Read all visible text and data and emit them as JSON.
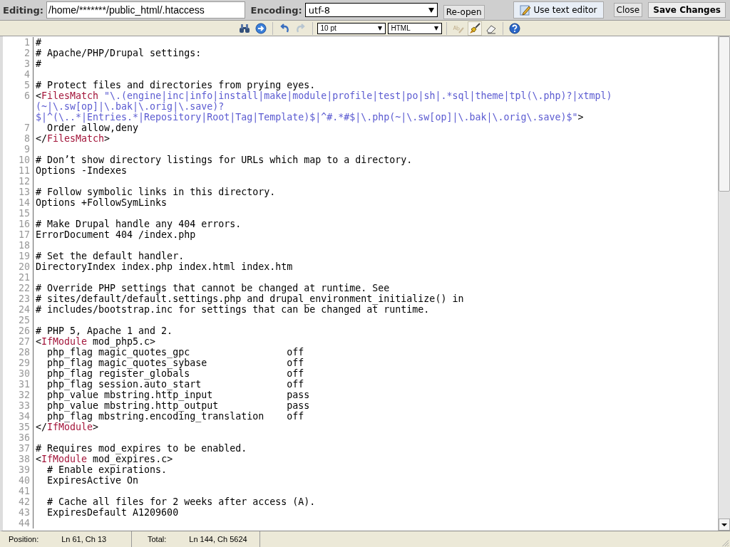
{
  "top_bar": {
    "editing_label": "Editing:",
    "file_path": "/home/*******/public_html/.htaccess",
    "encoding_label": "Encoding:",
    "encoding": "utf-8",
    "buttons": [
      {
        "kind": "reopen",
        "label": "Re-open"
      },
      {
        "kind": "text-editor",
        "label": "Use text editor"
      },
      {
        "kind": "close",
        "label": "Close"
      },
      {
        "kind": "save",
        "label": "Save Changes"
      }
    ]
  },
  "toolbar": [
    {
      "kind": "find",
      "disabled": false,
      "selected": false
    },
    {
      "kind": "goto",
      "disabled": false,
      "selected": false
    },
    {
      "kind": "sep"
    },
    {
      "kind": "undo",
      "disabled": false,
      "selected": false
    },
    {
      "kind": "redo",
      "disabled": true,
      "selected": false
    },
    {
      "kind": "sep"
    },
    {
      "kind": "select",
      "value": "10 pt"
    },
    {
      "kind": "select",
      "value": "HTML"
    },
    {
      "kind": "sep"
    },
    {
      "kind": "spell",
      "disabled": true,
      "selected": false
    },
    {
      "kind": "highlight",
      "disabled": false,
      "selected": true
    },
    {
      "kind": "eraser",
      "disabled": false,
      "selected": false
    },
    {
      "kind": "sep"
    },
    {
      "kind": "help",
      "disabled": false,
      "selected": false
    }
  ],
  "editor": {
    "lines": [
      {
        "number": "1",
        "rows": [
          [
            {
              "kind": "plain",
              "text": "#"
            }
          ]
        ]
      },
      {
        "number": "2",
        "rows": [
          [
            {
              "kind": "plain",
              "text": "# Apache/PHP/Drupal settings:"
            }
          ]
        ]
      },
      {
        "number": "3",
        "rows": [
          [
            {
              "kind": "plain",
              "text": "#"
            }
          ]
        ]
      },
      {
        "number": "4",
        "rows": [
          []
        ]
      },
      {
        "number": "5",
        "rows": [
          [
            {
              "kind": "plain",
              "text": "# Protect files and directories from prying eyes."
            }
          ]
        ]
      },
      {
        "number": "6",
        "rows": [
          [
            {
              "kind": "punct",
              "text": "<"
            },
            {
              "kind": "tag",
              "text": "FilesMatch"
            },
            {
              "kind": "string",
              "text": " \"\\.(engine|inc|info|install|make|module|profile|test|po|sh|.*sql|theme|tpl(\\.php)?|xtmpl)"
            },
            {
              "kind": "break"
            },
            {
              "kind": "string",
              "text": "(~|\\.sw[op]|\\.bak|\\.orig|\\.save)?"
            },
            {
              "kind": "break"
            },
            {
              "kind": "string",
              "text": "$|^(\\..*|Entries.*|Repository|Root|Tag|Template)$|^#.*#$|\\.php(~|\\.sw[op]|\\.bak|\\.orig\\.save)$\""
            },
            {
              "kind": "punct",
              "text": ">"
            }
          ]
        ]
      },
      {
        "number": "7",
        "rows": [
          [
            {
              "kind": "plain",
              "text": "  Order allow,deny"
            }
          ]
        ]
      },
      {
        "number": "8",
        "rows": [
          [
            {
              "kind": "punct",
              "text": "</"
            },
            {
              "kind": "tag",
              "text": "FilesMatch"
            },
            {
              "kind": "punct",
              "text": ">"
            }
          ]
        ]
      },
      {
        "number": "9",
        "rows": [
          []
        ]
      },
      {
        "number": "10",
        "rows": [
          [
            {
              "kind": "plain",
              "text": "# Don’t show directory listings for URLs which map to a directory."
            }
          ]
        ]
      },
      {
        "number": "11",
        "rows": [
          [
            {
              "kind": "plain",
              "text": "Options -Indexes"
            }
          ]
        ]
      },
      {
        "number": "12",
        "rows": [
          []
        ]
      },
      {
        "number": "13",
        "rows": [
          [
            {
              "kind": "plain",
              "text": "# Follow symbolic links in this directory."
            }
          ]
        ]
      },
      {
        "number": "14",
        "rows": [
          [
            {
              "kind": "plain",
              "text": "Options +FollowSymLinks"
            }
          ]
        ]
      },
      {
        "number": "15",
        "rows": [
          []
        ]
      },
      {
        "number": "16",
        "rows": [
          [
            {
              "kind": "plain",
              "text": "# Make Drupal handle any 404 errors."
            }
          ]
        ]
      },
      {
        "number": "17",
        "rows": [
          [
            {
              "kind": "plain",
              "text": "ErrorDocument 404 /index.php"
            }
          ]
        ]
      },
      {
        "number": "18",
        "rows": [
          []
        ]
      },
      {
        "number": "19",
        "rows": [
          [
            {
              "kind": "plain",
              "text": "# Set the default handler."
            }
          ]
        ]
      },
      {
        "number": "20",
        "rows": [
          [
            {
              "kind": "plain",
              "text": "DirectoryIndex index.php index.html index.htm"
            }
          ]
        ]
      },
      {
        "number": "21",
        "rows": [
          []
        ]
      },
      {
        "number": "22",
        "rows": [
          [
            {
              "kind": "plain",
              "text": "# Override PHP settings that cannot be changed at runtime. See"
            }
          ]
        ]
      },
      {
        "number": "23",
        "rows": [
          [
            {
              "kind": "plain",
              "text": "# sites/default/default.settings.php and drupal_environment_initialize() in"
            }
          ]
        ]
      },
      {
        "number": "24",
        "rows": [
          [
            {
              "kind": "plain",
              "text": "# includes/bootstrap.inc for settings that can be changed at runtime."
            }
          ]
        ]
      },
      {
        "number": "25",
        "rows": [
          []
        ]
      },
      {
        "number": "26",
        "rows": [
          [
            {
              "kind": "plain",
              "text": "# PHP 5, Apache 1 and 2."
            }
          ]
        ]
      },
      {
        "number": "27",
        "rows": [
          [
            {
              "kind": "punct",
              "text": "<"
            },
            {
              "kind": "tag",
              "text": "IfModule"
            },
            {
              "kind": "plain",
              "text": " mod_php5.c>"
            }
          ]
        ]
      },
      {
        "number": "28",
        "rows": [
          [
            {
              "kind": "plain",
              "text": "  php_flag magic_quotes_gpc                 off"
            }
          ]
        ]
      },
      {
        "number": "29",
        "rows": [
          [
            {
              "kind": "plain",
              "text": "  php_flag magic_quotes_sybase              off"
            }
          ]
        ]
      },
      {
        "number": "30",
        "rows": [
          [
            {
              "kind": "plain",
              "text": "  php_flag register_globals                 off"
            }
          ]
        ]
      },
      {
        "number": "31",
        "rows": [
          [
            {
              "kind": "plain",
              "text": "  php_flag session.auto_start               off"
            }
          ]
        ]
      },
      {
        "number": "32",
        "rows": [
          [
            {
              "kind": "plain",
              "text": "  php_value mbstring.http_input             pass"
            }
          ]
        ]
      },
      {
        "number": "33",
        "rows": [
          [
            {
              "kind": "plain",
              "text": "  php_value mbstring.http_output            pass"
            }
          ]
        ]
      },
      {
        "number": "34",
        "rows": [
          [
            {
              "kind": "plain",
              "text": "  php_flag mbstring.encoding_translation    off"
            }
          ]
        ]
      },
      {
        "number": "35",
        "rows": [
          [
            {
              "kind": "punct",
              "text": "</"
            },
            {
              "kind": "tag",
              "text": "IfModule"
            },
            {
              "kind": "punct",
              "text": ">"
            }
          ]
        ]
      },
      {
        "number": "36",
        "rows": [
          []
        ]
      },
      {
        "number": "37",
        "rows": [
          [
            {
              "kind": "plain",
              "text": "# Requires mod_expires to be enabled."
            }
          ]
        ]
      },
      {
        "number": "38",
        "rows": [
          [
            {
              "kind": "punct",
              "text": "<"
            },
            {
              "kind": "tag",
              "text": "IfModule"
            },
            {
              "kind": "plain",
              "text": " mod_expires.c>"
            }
          ]
        ]
      },
      {
        "number": "39",
        "rows": [
          [
            {
              "kind": "plain",
              "text": "  # Enable expirations."
            }
          ]
        ]
      },
      {
        "number": "40",
        "rows": [
          [
            {
              "kind": "plain",
              "text": "  ExpiresActive On"
            }
          ]
        ]
      },
      {
        "number": "41",
        "rows": [
          []
        ]
      },
      {
        "number": "42",
        "rows": [
          [
            {
              "kind": "plain",
              "text": "  # Cache all files for 2 weeks after access (A)."
            }
          ]
        ]
      },
      {
        "number": "43",
        "rows": [
          [
            {
              "kind": "plain",
              "text": "  ExpiresDefault A1209600"
            }
          ]
        ]
      },
      {
        "number": "44",
        "rows": [
          []
        ]
      }
    ]
  },
  "status_bar": {
    "position_label": "Position:",
    "position": "Ln 61, Ch 13",
    "total_label": "Total:",
    "total": "Ln 144, Ch 5624"
  }
}
